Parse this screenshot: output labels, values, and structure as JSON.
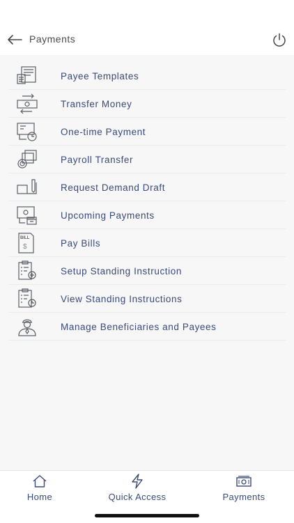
{
  "header": {
    "title": "Payments",
    "back_icon": "arrow-left-icon",
    "power_icon": "power-icon"
  },
  "menu": {
    "items": [
      {
        "label": "Payee Templates",
        "icon": "payee-template-icon"
      },
      {
        "label": "Transfer Money",
        "icon": "transfer-money-icon"
      },
      {
        "label": "One-time Payment",
        "icon": "one-time-payment-icon"
      },
      {
        "label": "Payroll Transfer",
        "icon": "payroll-transfer-icon"
      },
      {
        "label": "Request Demand Draft",
        "icon": "demand-draft-icon"
      },
      {
        "label": "Upcoming Payments",
        "icon": "upcoming-payments-icon"
      },
      {
        "label": "Pay Bills",
        "icon": "bill-icon"
      },
      {
        "label": "Setup Standing Instruction",
        "icon": "clipboard-add-icon"
      },
      {
        "label": "View Standing Instructions",
        "icon": "clipboard-clock-icon"
      },
      {
        "label": "Manage Beneficiaries and Payees",
        "icon": "beneficiary-person-icon"
      }
    ]
  },
  "bill_icon_text": "BILL",
  "bottom_nav": {
    "items": [
      {
        "label": "Home",
        "icon": "home-icon"
      },
      {
        "label": "Quick Access",
        "icon": "lightning-icon"
      },
      {
        "label": "Payments",
        "icon": "banknote-icon"
      }
    ]
  },
  "colors": {
    "text_primary": "#3a4a7a",
    "list_background": "#f7f7f7",
    "icon_stroke": "#5a5f66"
  }
}
